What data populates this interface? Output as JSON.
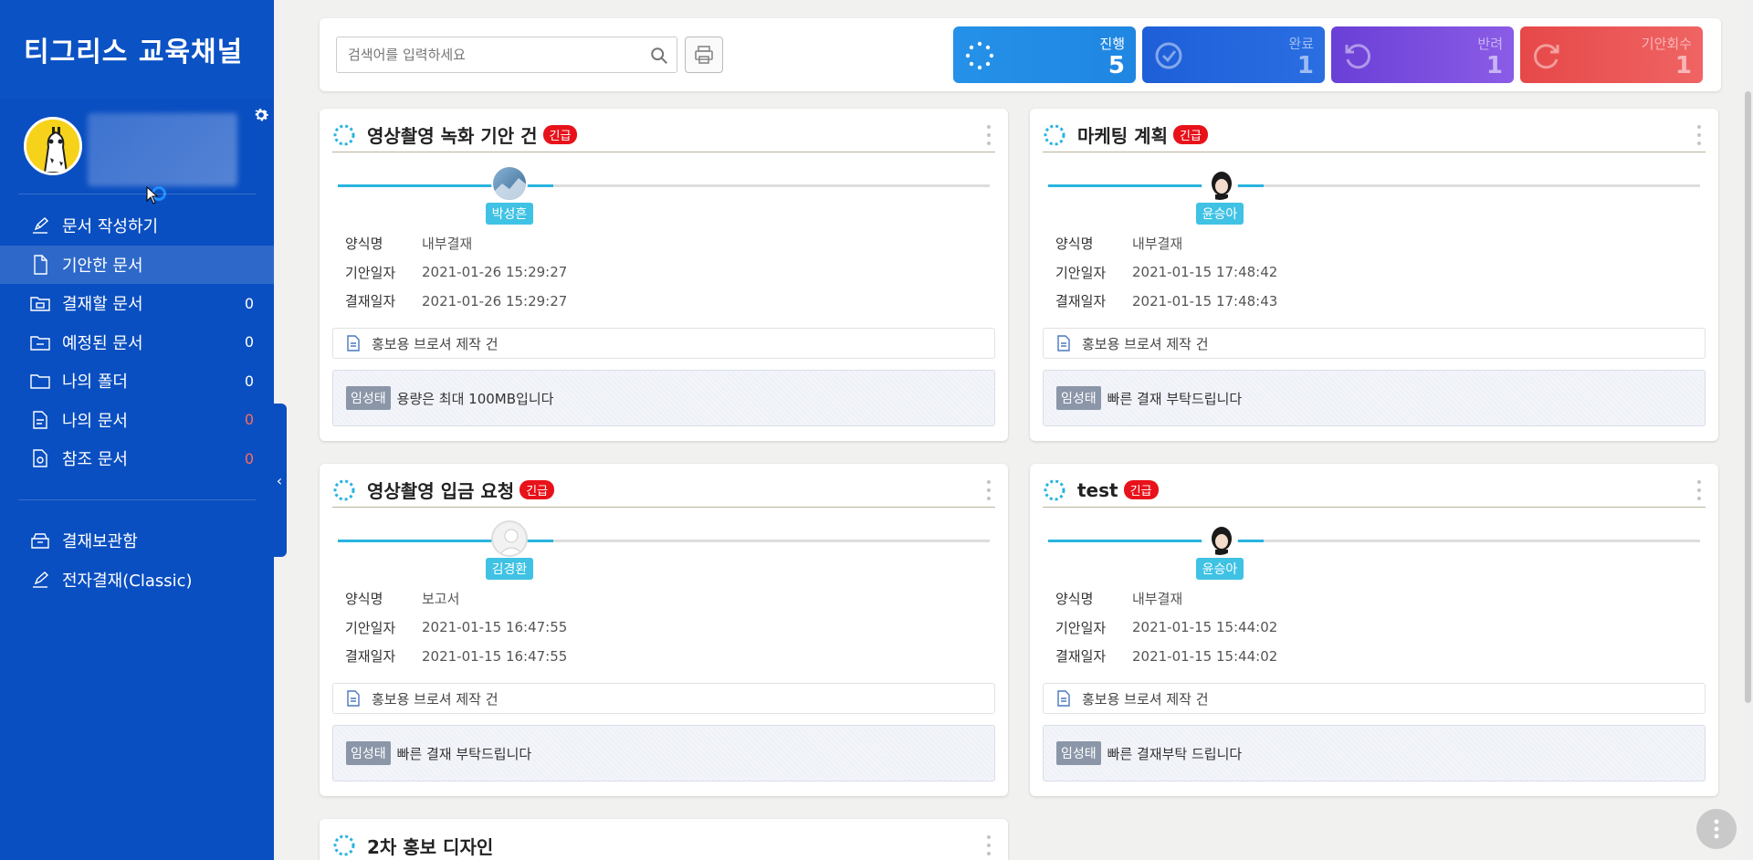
{
  "sidebar": {
    "brand": "티그리스 교육채널",
    "nav": [
      {
        "label": "문서 작성하기",
        "count": "",
        "icon": "pen-document-icon"
      },
      {
        "label": "기안한 문서",
        "count": "",
        "icon": "document-icon",
        "active": true
      },
      {
        "label": "결재할 문서",
        "count": "0",
        "icon": "inbox-folder-icon"
      },
      {
        "label": "예정된 문서",
        "count": "0",
        "icon": "scheduled-folder-icon"
      },
      {
        "label": "나의 폴더",
        "count": "0",
        "icon": "folder-icon"
      },
      {
        "label": "나의 문서",
        "count": "0",
        "icon": "my-document-icon",
        "count_color": "red"
      },
      {
        "label": "참조 문서",
        "count": "0",
        "icon": "reference-document-icon",
        "count_color": "red"
      }
    ],
    "nav2": [
      {
        "label": "결재보관함",
        "icon": "archive-box-icon"
      },
      {
        "label": "전자결재(Classic)",
        "icon": "pen-document-icon"
      }
    ]
  },
  "toolbar": {
    "search_placeholder": "검색어를 입력하세요",
    "stats": [
      {
        "label": "진행",
        "value": "5",
        "icon": "progress-spinner-icon"
      },
      {
        "label": "완료",
        "value": "1",
        "icon": "check-circle-icon"
      },
      {
        "label": "반려",
        "value": "1",
        "icon": "rotate-left-icon"
      },
      {
        "label": "기안회수",
        "value": "1",
        "icon": "rotate-right-icon"
      }
    ]
  },
  "cards": [
    {
      "title": "영상촬영 녹화 기안 건",
      "badge": "긴급",
      "approver": "박성흔",
      "rows": [
        {
          "key": "양식명",
          "value": "내부결재"
        },
        {
          "key": "기안일자",
          "value": "2021-01-26 15:29:27"
        },
        {
          "key": "결재일자",
          "value": "2021-01-26 15:29:27"
        }
      ],
      "doc": "홍보용 브로셔 제작 건",
      "comment_author": "임성태",
      "comment": "용량은 최대 100MB입니다"
    },
    {
      "title": "마케팅 계획",
      "badge": "긴급",
      "approver": "윤승아",
      "rows": [
        {
          "key": "양식명",
          "value": "내부결재"
        },
        {
          "key": "기안일자",
          "value": "2021-01-15 17:48:42"
        },
        {
          "key": "결재일자",
          "value": "2021-01-15 17:48:43"
        }
      ],
      "doc": "홍보용 브로셔 제작 건",
      "comment_author": "임성태",
      "comment": "빠른 결재 부탁드립니다"
    },
    {
      "title": "영상촬영 입금 요청",
      "badge": "긴급",
      "approver": "김경환",
      "rows": [
        {
          "key": "양식명",
          "value": "보고서"
        },
        {
          "key": "기안일자",
          "value": "2021-01-15 16:47:55"
        },
        {
          "key": "결재일자",
          "value": "2021-01-15 16:47:55"
        }
      ],
      "doc": "홍보용 브로셔 제작 건",
      "comment_author": "임성태",
      "comment": "빠른 결재 부탁드립니다"
    },
    {
      "title": "test",
      "badge": "긴급",
      "approver": "윤승아",
      "rows": [
        {
          "key": "양식명",
          "value": "내부결재"
        },
        {
          "key": "기안일자",
          "value": "2021-01-15 15:44:02"
        },
        {
          "key": "결재일자",
          "value": "2021-01-15 15:44:02"
        }
      ],
      "doc": "홍보용 브로셔 제작 건",
      "comment_author": "임성태",
      "comment": "빠른 결재부탁 드립니다"
    },
    {
      "title": "2차 홍보 디자인"
    }
  ],
  "colors": {
    "sidebar": "#0a4fc1",
    "accent": "#29b4df",
    "urgent": "#e8121a",
    "count_red": "#ff6b5b"
  }
}
